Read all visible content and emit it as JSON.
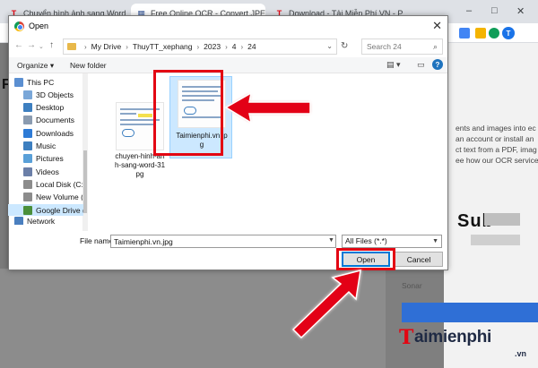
{
  "browser": {
    "tabs": [
      {
        "label": "Chuyển hình ảnh sang Word, đổ",
        "favicon": "T",
        "favicon_color": "#e30613"
      },
      {
        "label": "Free Online OCR - Convert JPEG",
        "favicon": "▦",
        "favicon_color": "#3a5a9a"
      },
      {
        "label": "Download - Tải Miễn Phí VN - P",
        "favicon": "T",
        "favicon_color": "#e30613"
      }
    ],
    "avatar_letter": "T",
    "window_controls": [
      "–",
      "□",
      "✕"
    ]
  },
  "page": {
    "lines": [
      "ents and images into ec",
      "an account or install an",
      "ct text from a PDF, imag",
      "ee how our OCR service"
    ],
    "heading": "Sub",
    "sonar": "Sonar",
    "left_letter": "F"
  },
  "dialog": {
    "title": "Open",
    "breadcrumb": [
      "My Drive",
      "ThuyTT_xephang",
      "2023",
      "4",
      "24"
    ],
    "search_placeholder": "Search 24",
    "toolbar": {
      "organize": "Organize",
      "new_folder": "New folder"
    },
    "nav_items": [
      {
        "label": "This PC",
        "icon": "pc-icon",
        "color": "#5b8fd1"
      },
      {
        "label": "3D Objects",
        "icon": "cube-icon",
        "color": "#7aa7d8"
      },
      {
        "label": "Desktop",
        "icon": "desktop-icon",
        "color": "#3d7fc0"
      },
      {
        "label": "Documents",
        "icon": "documents-icon",
        "color": "#8a9bb0"
      },
      {
        "label": "Downloads",
        "icon": "download-icon",
        "color": "#2e7bd6"
      },
      {
        "label": "Music",
        "icon": "music-icon",
        "color": "#3d7fc0"
      },
      {
        "label": "Pictures",
        "icon": "pictures-icon",
        "color": "#5aa0d8"
      },
      {
        "label": "Videos",
        "icon": "videos-icon",
        "color": "#6b7fa8"
      },
      {
        "label": "Local Disk (C:)",
        "icon": "disk-icon",
        "color": "#8c8c8c"
      },
      {
        "label": "New Volume (D:",
        "icon": "disk-icon",
        "color": "#8c8c8c"
      },
      {
        "label": "Google Drive (G:",
        "icon": "drive-icon",
        "color": "#4a8f3a"
      },
      {
        "label": "Network",
        "icon": "network-icon",
        "color": "#4a7fbf"
      }
    ],
    "files": [
      {
        "name": "chuyen-hinh-anh-sang-word-31.jpg",
        "name_display": "chuyen-hinh-an\nh-sang-word-31\npg",
        "selected": false
      },
      {
        "name": "Taimienphi.vn.jpg",
        "name_display": "Taimienphi.vn.jp\ng",
        "selected": true
      }
    ],
    "file_name_label": "File name:",
    "file_name_value": "Taimienphi.vn.jpg",
    "file_type": "All Files (*.*)",
    "open_label": "Open",
    "cancel_label": "Cancel"
  },
  "watermark": {
    "brand": "aimienphi",
    "tld": ".vn",
    "logo_letter": "T"
  },
  "colors": {
    "highlight": "#e30613",
    "selection": "#cce8ff",
    "accent": "#0078d7"
  }
}
